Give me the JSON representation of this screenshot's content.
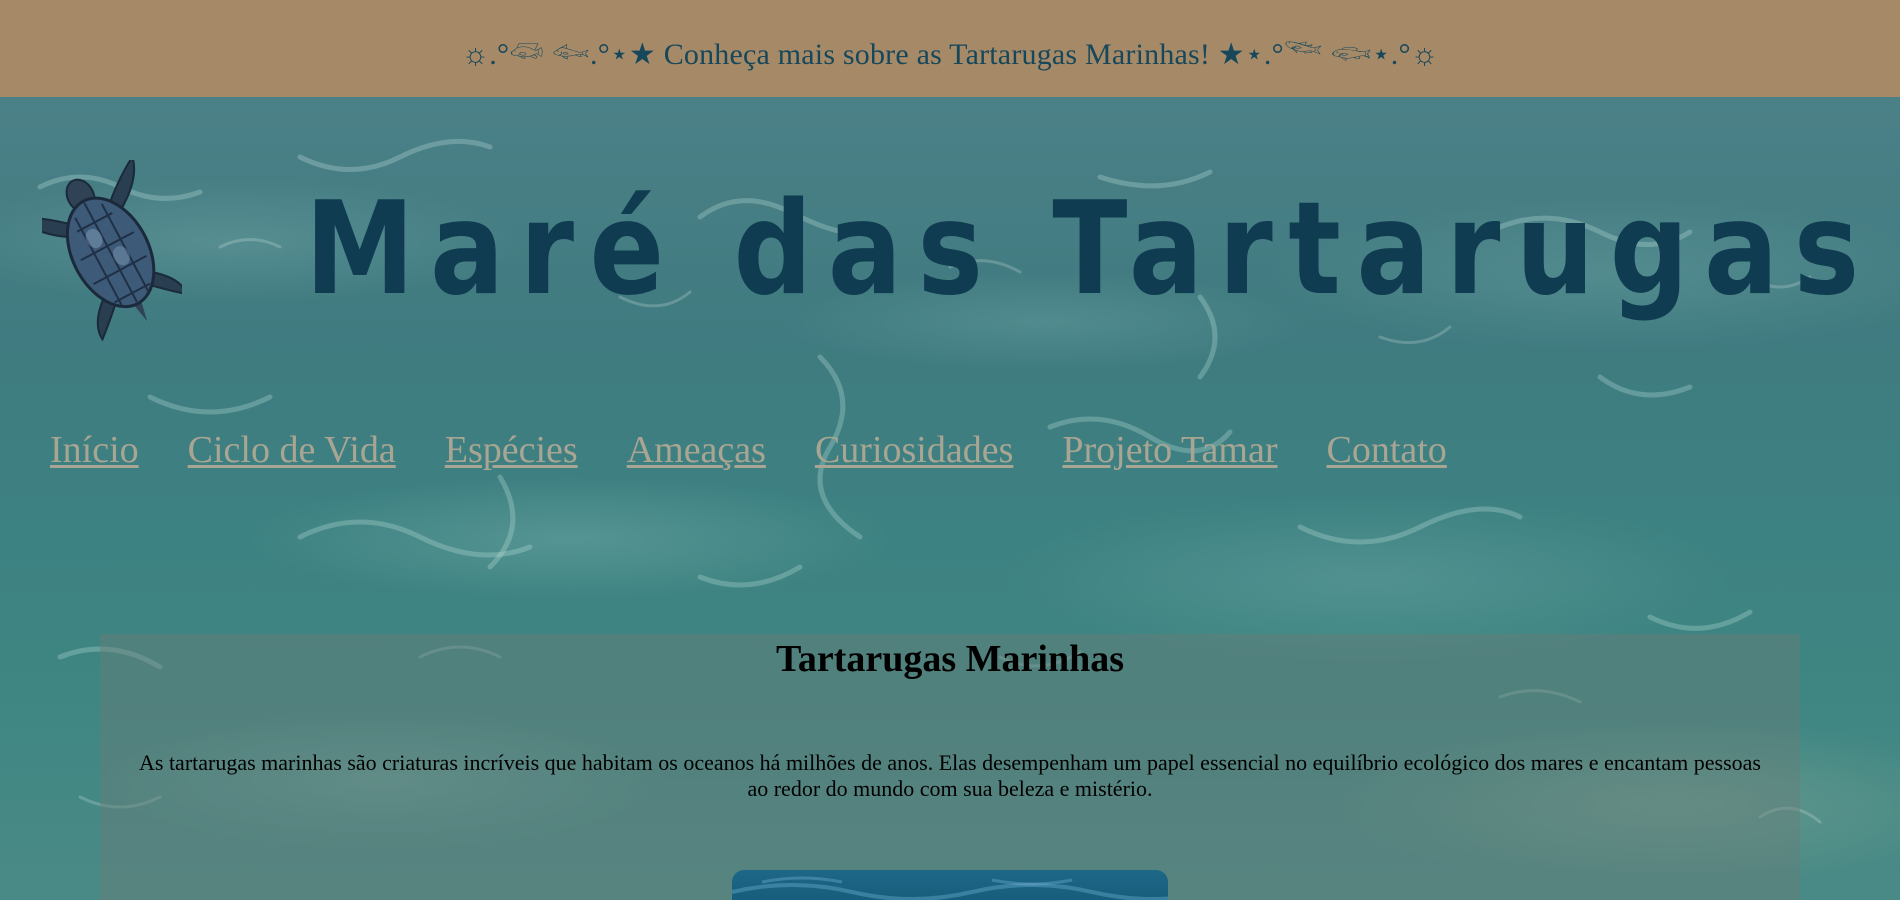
{
  "banner": {
    "text": "☼.°𓆛 𓆜.°⋆★ Conheça mais sobre as Tartarugas Marinhas! ★⋆.°𓆝 𓆟⋆.°☼"
  },
  "header": {
    "title": "Maré das Tartarugas",
    "logo_icon": "sea-turtle-icon"
  },
  "nav": {
    "items": [
      {
        "label": "Início"
      },
      {
        "label": "Ciclo de Vida"
      },
      {
        "label": "Espécies"
      },
      {
        "label": "Ameaças"
      },
      {
        "label": "Curiosidades"
      },
      {
        "label": "Projeto Tamar"
      },
      {
        "label": "Contato"
      }
    ]
  },
  "main": {
    "title": "Tartarugas Marinhas",
    "intro": "As tartarugas marinhas são criaturas incríveis que habitam os oceanos há milhões de anos. Elas desempenham um papel essencial no equilíbrio ecológico dos mares e encantam pessoas ao redor do mundo com sua beleza e mistério."
  },
  "colors": {
    "banner_bg": "#a68a68",
    "banner_text": "#17475a",
    "title": "#0f3c50",
    "nav_link": "#a9a593",
    "water": "#3e7a82"
  }
}
